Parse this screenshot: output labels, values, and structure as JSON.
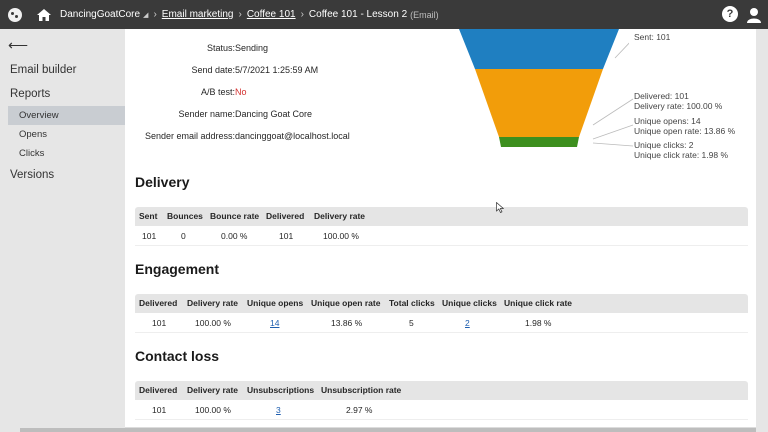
{
  "topbar": {
    "site": "DancingGoatCore",
    "crumbs": [
      "Email marketing",
      "Coffee 101"
    ],
    "current": "Coffee 101 - Lesson 2",
    "current_suffix": "(Email)",
    "help": "?"
  },
  "sidebar": {
    "back": "⟵",
    "items": [
      {
        "label": "Email builder"
      },
      {
        "label": "Reports"
      },
      {
        "label": "Overview"
      },
      {
        "label": "Opens"
      },
      {
        "label": "Clicks"
      },
      {
        "label": "Versions"
      }
    ]
  },
  "info": [
    {
      "label": "Status:",
      "value": "Sending"
    },
    {
      "label": "Send date:",
      "value": "5/7/2021 1:25:59 AM"
    },
    {
      "label": "A/B test:",
      "value": "No"
    },
    {
      "label": "Sender name:",
      "value": "Dancing Goat Core"
    },
    {
      "label": "Sender email address:",
      "value": "dancinggoat@localhost.local"
    }
  ],
  "funnel": {
    "colors": {
      "sent": "#1f7fc1",
      "delivered": "#f29d0a",
      "clicks": "#3d8f1e"
    },
    "labels": {
      "sent": "Sent: 101",
      "delivered": "Delivered: 101",
      "delivery_rate": "Delivery rate: 100.00 %",
      "opens": "Unique opens: 14",
      "open_rate": "Unique open rate: 13.86 %",
      "clicks": "Unique clicks: 2",
      "click_rate": "Unique click rate: 1.98 %"
    }
  },
  "delivery": {
    "title": "Delivery",
    "headers": [
      "Sent",
      "Bounces",
      "Bounce rate",
      "Delivered",
      "Delivery rate"
    ],
    "row": [
      "101",
      "0",
      "0.00 %",
      "101",
      "100.00 %"
    ]
  },
  "engagement": {
    "title": "Engagement",
    "headers": [
      "Delivered",
      "Delivery rate",
      "Unique opens",
      "Unique open rate",
      "Total clicks",
      "Unique clicks",
      "Unique click rate"
    ],
    "row": [
      "101",
      "100.00 %",
      "14",
      "13.86 %",
      "5",
      "2",
      "1.98 %"
    ]
  },
  "contact_loss": {
    "title": "Contact loss",
    "headers": [
      "Delivered",
      "Delivery rate",
      "Unsubscriptions",
      "Unsubscription rate"
    ],
    "row": [
      "101",
      "100.00 %",
      "3",
      "2.97 %"
    ]
  }
}
